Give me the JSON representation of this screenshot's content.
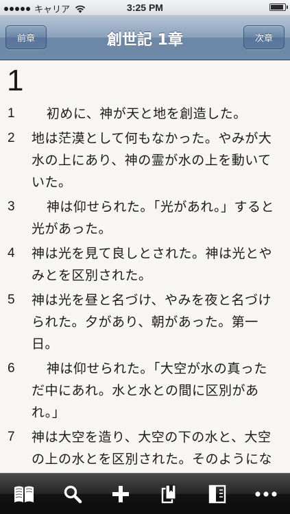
{
  "status_bar": {
    "carrier": "キャリア",
    "time": "3:25 PM",
    "battery_level": 0.92
  },
  "nav": {
    "prev_label": "前章",
    "title": "創世記 1章",
    "next_label": "次章"
  },
  "chapter": {
    "number": "1",
    "verses": [
      {
        "num": "1",
        "text": "初めに、神が天と地を創造した。",
        "indent": true
      },
      {
        "num": "2",
        "text": "地は茫漠として何もなかった。やみが大水の上にあり、神の霊が水の上を動いていた。",
        "indent": false
      },
      {
        "num": "3",
        "text": "神は仰せられた。「光があれ。」すると光があった。",
        "indent": true
      },
      {
        "num": "4",
        "text": "神は光を見て良しとされた。神は光とやみとを区別された。",
        "indent": false
      },
      {
        "num": "5",
        "text": "神は光を昼と名づけ、やみを夜と名づけられた。夕があり、朝があった。第一日。",
        "indent": false
      },
      {
        "num": "6",
        "text": "神は仰せられた。「大空が水の真っただ中にあれ。水と水との間に区別があれ。」",
        "indent": true
      },
      {
        "num": "7",
        "text": "神は大空を造り、大空の下の水と、大空の上の水とを区別された。そのようになった。",
        "indent": false
      }
    ]
  },
  "toolbar": {
    "icons": [
      "book-icon",
      "search-icon",
      "plus-icon",
      "bookmark-icon",
      "compare-icon",
      "more-icon"
    ]
  },
  "colors": {
    "nav_accent": "#7f98b6",
    "text": "#1a1a1a",
    "page_background": "#f7f6f2",
    "toolbar_icon": "#ffffff"
  }
}
